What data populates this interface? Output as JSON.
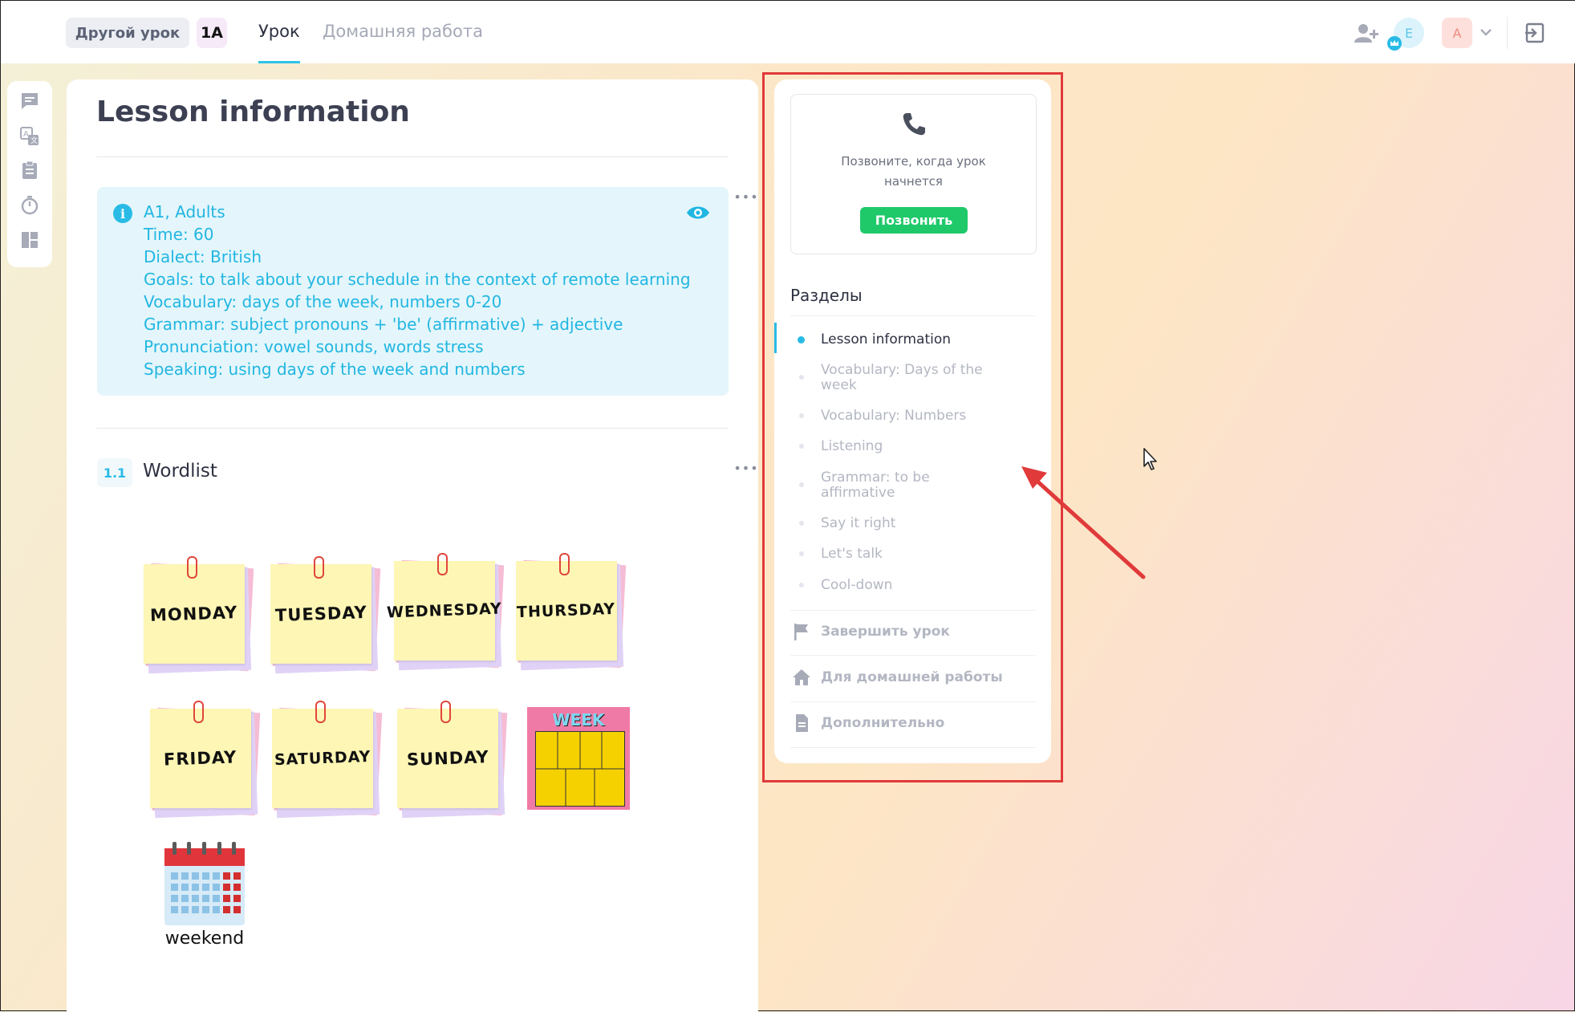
{
  "header": {
    "other_lesson": "Другой урок",
    "group": "1A",
    "tabs": [
      {
        "label": "Урок",
        "active": true
      },
      {
        "label": "Домашняя работа",
        "active": false
      }
    ],
    "avatar_student": "E",
    "avatar_teacher": "A",
    "icons": [
      "add-user-icon",
      "crown-icon",
      "chevron-down-icon",
      "exit-icon"
    ]
  },
  "sidebar": {
    "icons": [
      "chat-icon",
      "translate-icon",
      "clipboard-icon",
      "timer-icon",
      "layout-icon"
    ]
  },
  "main": {
    "title": "Lesson information",
    "info_lines": [
      "A1, Adults",
      "Time: 60",
      "Dialect: British",
      "Goals: to talk about your schedule in the context of remote learning",
      "Vocabulary: days of the week, numbers 0-20",
      "Grammar: subject pronouns + 'be' (affirmative) + adjective",
      "Pronunciation: vowel sounds, words stress",
      "Speaking: using days of the week and numbers"
    ],
    "section_number": "1.1",
    "section_title": "Wordlist",
    "notes": [
      "MONDAY",
      "TUESDAY",
      "WEDNESDAY",
      "THURSDAY",
      "FRIDAY",
      "SATURDAY",
      "SUNDAY"
    ],
    "week_card": "WEEK",
    "weekend_label": "weekend",
    "more_label": "•••"
  },
  "right_panel": {
    "call_text": "Позвоните, когда урок начнется",
    "call_button": "Позвонить",
    "sections_heading": "Разделы",
    "sections": [
      {
        "label": "Lesson information",
        "active": true
      },
      {
        "label": "Vocabulary: Days of the week",
        "active": false
      },
      {
        "label": "Vocabulary: Numbers",
        "active": false
      },
      {
        "label": "Listening",
        "active": false
      },
      {
        "label": "Grammar: to be affirmative",
        "active": false
      },
      {
        "label": "Say it right",
        "active": false
      },
      {
        "label": "Let's talk",
        "active": false
      },
      {
        "label": "Cool-down",
        "active": false
      }
    ],
    "actions": [
      {
        "label": "Завершить урок",
        "icon": "flag-icon"
      },
      {
        "label": "Для домашней работы",
        "icon": "home-icon"
      },
      {
        "label": "Дополнительно",
        "icon": "document-icon"
      }
    ]
  },
  "colors": {
    "accent": "#29bbe6",
    "call_green": "#1fc96a",
    "annotation_red": "#e03a3a"
  }
}
